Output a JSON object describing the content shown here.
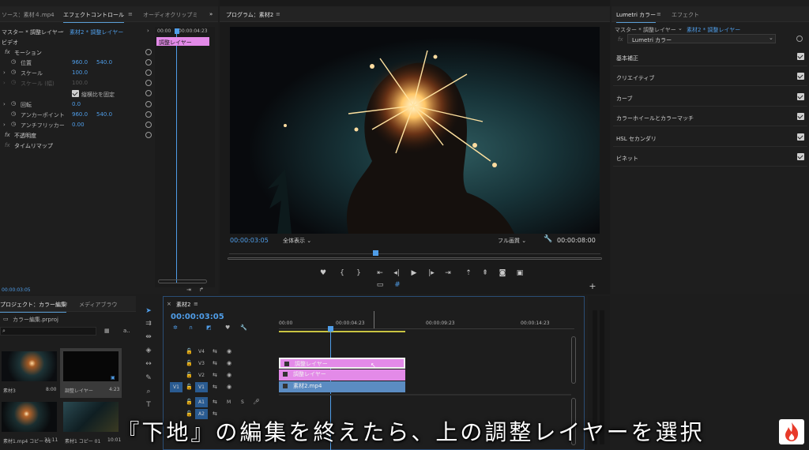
{
  "effect_controls": {
    "tabs": [
      "ソース：素材４.mp4",
      "エフェクトコントロール",
      "オーディオクリップミ"
    ],
    "master_label": "マスター * 調整レイヤー",
    "clip_label": "素材2 * 調整レイヤー",
    "section_video": "ビデオ",
    "motion": "モーション",
    "position_label": "位置",
    "position_x": "960.0",
    "position_y": "540.0",
    "scale_label": "スケール",
    "scale_value": "100.0",
    "scale_w_label": "スケール (幅)",
    "scale_w_value": "100.0",
    "uniform_scale": "縦横比を固定",
    "rotation_label": "回転",
    "rotation_value": "0.0",
    "anchor_label": "アンカーポイント",
    "anchor_x": "960.0",
    "anchor_y": "540.0",
    "antiflicker_label": "アンチフリッカー",
    "antiflicker_value": "0.00",
    "opacity": "不透明度",
    "time_remap": "タイムリマップ",
    "mini_time_start": "00:00",
    "mini_time_mark": "00:00:04:23",
    "mini_clip": "調整レイヤー",
    "current_time": "00:00:03:05"
  },
  "program": {
    "tab": "プログラム：素材2",
    "timecode": "00:00:03:05",
    "zoom": "全体表示",
    "quality": "フル画質",
    "duration": "00:00:08:00"
  },
  "lumetri": {
    "tabs": [
      "Lumetri カラー",
      "エフェクト"
    ],
    "master_label": "マスター * 調整レイヤー",
    "clip_label": "素材2 * 調整レイヤー",
    "effect_name": "Lumetri カラー",
    "sections": [
      "基本補正",
      "クリエイティブ",
      "カーブ",
      "カラーホイールとカラーマッチ",
      "HSL セカンダリ",
      "ビネット"
    ]
  },
  "project": {
    "tabs": [
      "プロジェクト：カラー編集",
      "メディアブラウ"
    ],
    "file": "カラー編集.prproj",
    "items": [
      {
        "name": "素材3",
        "duration": "8:00"
      },
      {
        "name": "調整レイヤー",
        "duration": "4:23"
      },
      {
        "name": "素材1.mp4 コピー 01",
        "duration": "31:11"
      },
      {
        "name": "素材1 コピー 01",
        "duration": "10:01"
      }
    ]
  },
  "timeline": {
    "tab": "素材2",
    "timecode": "00:00:03:05",
    "ruler": [
      "00:00",
      "00:00:04:23",
      "00:00:09:23",
      "00:00:14:23"
    ],
    "tracks": [
      "V4",
      "V3",
      "V2",
      "V1",
      "A1",
      "A2"
    ],
    "source_patch": [
      "V1",
      "A1",
      "A2"
    ],
    "clips": [
      {
        "track": "V3",
        "label": "調整レイヤー"
      },
      {
        "track": "V2",
        "label": "調整レイヤー"
      },
      {
        "track": "V1",
        "label": "素材2.mp4"
      }
    ],
    "audio_m": "M",
    "audio_s": "S"
  },
  "subtitle": "『下地』の編集を終えたら、上の調整レイヤーを選択",
  "colors": {
    "accent": "#4f9de8",
    "adjustment_clip": "#e38ae8",
    "video_clip": "#5b8cc2",
    "logo": "#e83a2a"
  }
}
